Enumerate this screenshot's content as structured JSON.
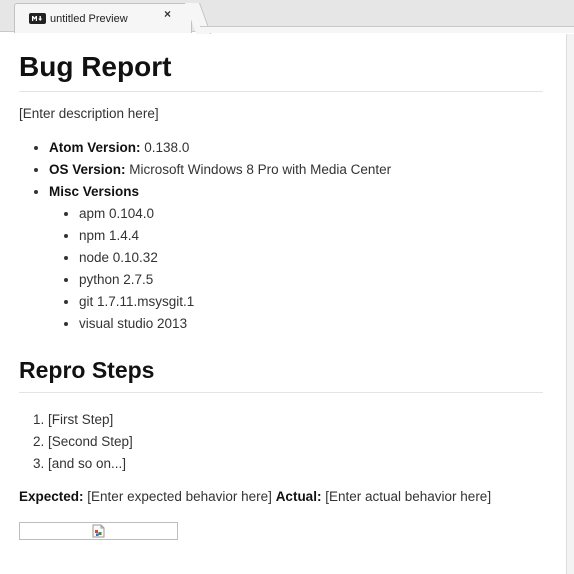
{
  "tab": {
    "icon": "markdown-icon",
    "title": "untitled Preview",
    "close": "×"
  },
  "doc": {
    "title": "Bug Report",
    "description": "[Enter description here]",
    "env": {
      "atom_label": "Atom Version:",
      "atom_value": "0.138.0",
      "os_label": "OS Version:",
      "os_value": "Microsoft Windows 8 Pro with Media Center",
      "misc_label": "Misc Versions",
      "misc": [
        "apm 0.104.0",
        "npm 1.4.4",
        "node 0.10.32",
        "python 2.7.5",
        "git 1.7.11.msysgit.1",
        "visual studio 2013"
      ]
    },
    "repro_title": "Repro Steps",
    "steps": [
      "[First Step]",
      "[Second Step]",
      "[and so on...]"
    ],
    "expected_label": "Expected:",
    "expected_value": "[Enter expected behavior here]",
    "actual_label": "Actual:",
    "actual_value": "[Enter actual behavior here]",
    "image_icon": "broken-image-icon"
  }
}
